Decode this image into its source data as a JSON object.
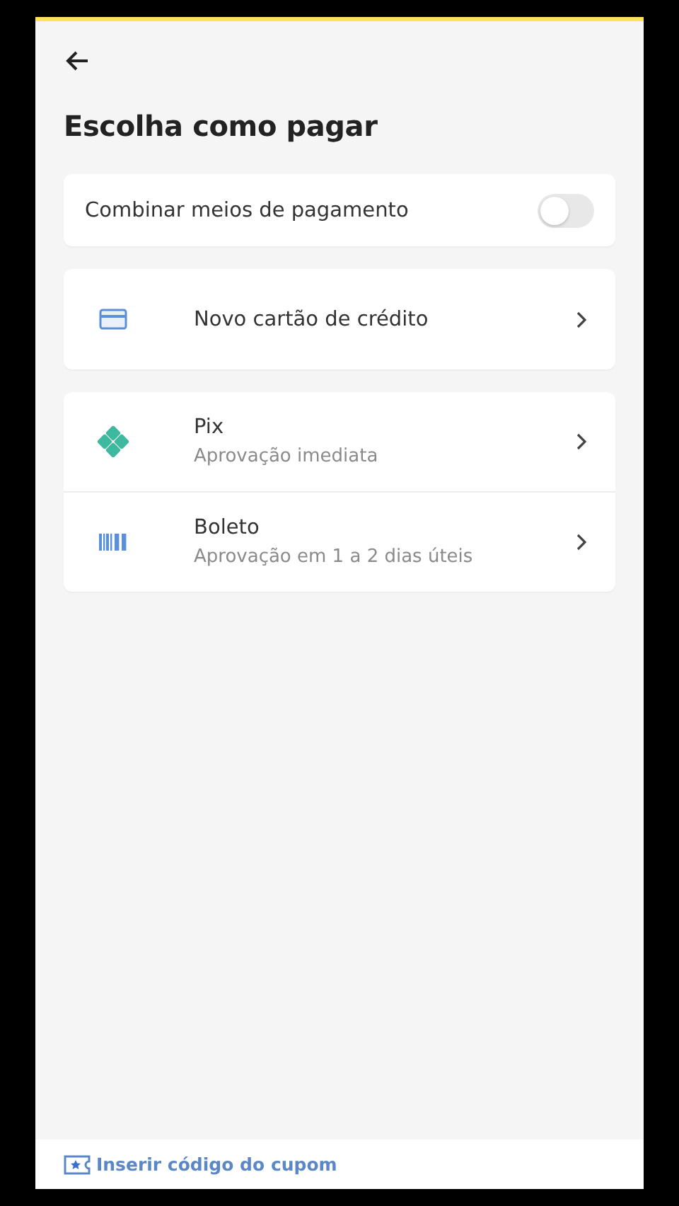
{
  "title": "Escolha como pagar",
  "combine": {
    "label": "Combinar meios de pagamento",
    "on": false
  },
  "method_groups": [
    {
      "items": [
        {
          "kind": "card",
          "label": "Novo cartão de crédito"
        }
      ]
    },
    {
      "items": [
        {
          "kind": "pix",
          "label": "Pix",
          "subtitle": "Aprovação imediata"
        },
        {
          "kind": "boleto",
          "label": "Boleto",
          "subtitle": "Aprovação em 1 a 2 dias úteis"
        }
      ]
    }
  ],
  "footer": {
    "coupon_link": "Inserir código do cupom"
  }
}
